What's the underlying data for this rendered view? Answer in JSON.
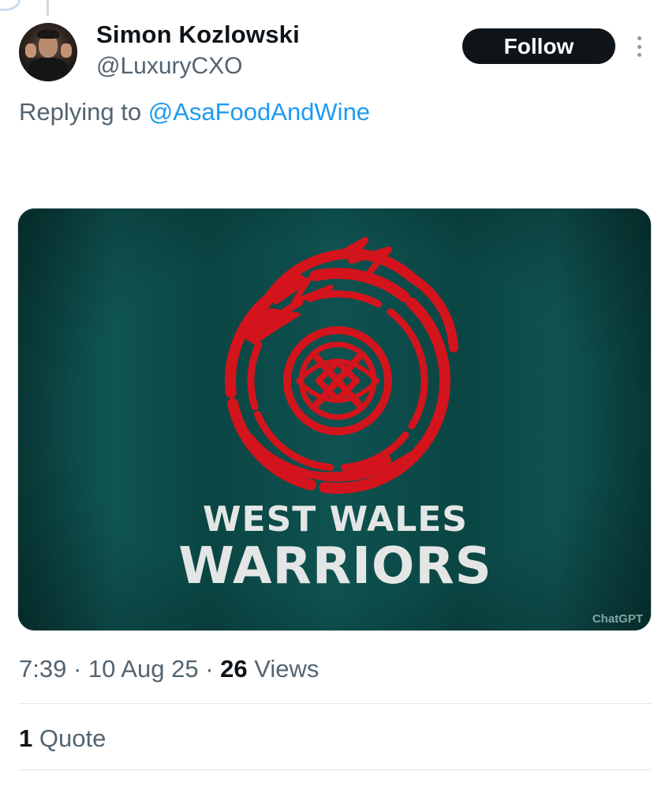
{
  "author": {
    "display_name": "Simon Kozlowski",
    "handle": "@LuxuryCXO"
  },
  "follow_label": "Follow",
  "reply": {
    "prefix": "Replying to",
    "mention": "@AsaFoodAndWine"
  },
  "media": {
    "line1": "WEST WALES",
    "line2": "WARRIORS",
    "watermark": "ChatGPT",
    "colors": {
      "flag": "#0c4a48",
      "emblem": "#d3141c",
      "text": "#e4e6e6"
    }
  },
  "meta": {
    "time": "7:39",
    "date": "10 Aug 25",
    "views_count": "26",
    "views_label": "Views"
  },
  "quotes": {
    "count": "1",
    "label": "Quote"
  },
  "icons": {
    "more": "more-vertical-icon"
  }
}
